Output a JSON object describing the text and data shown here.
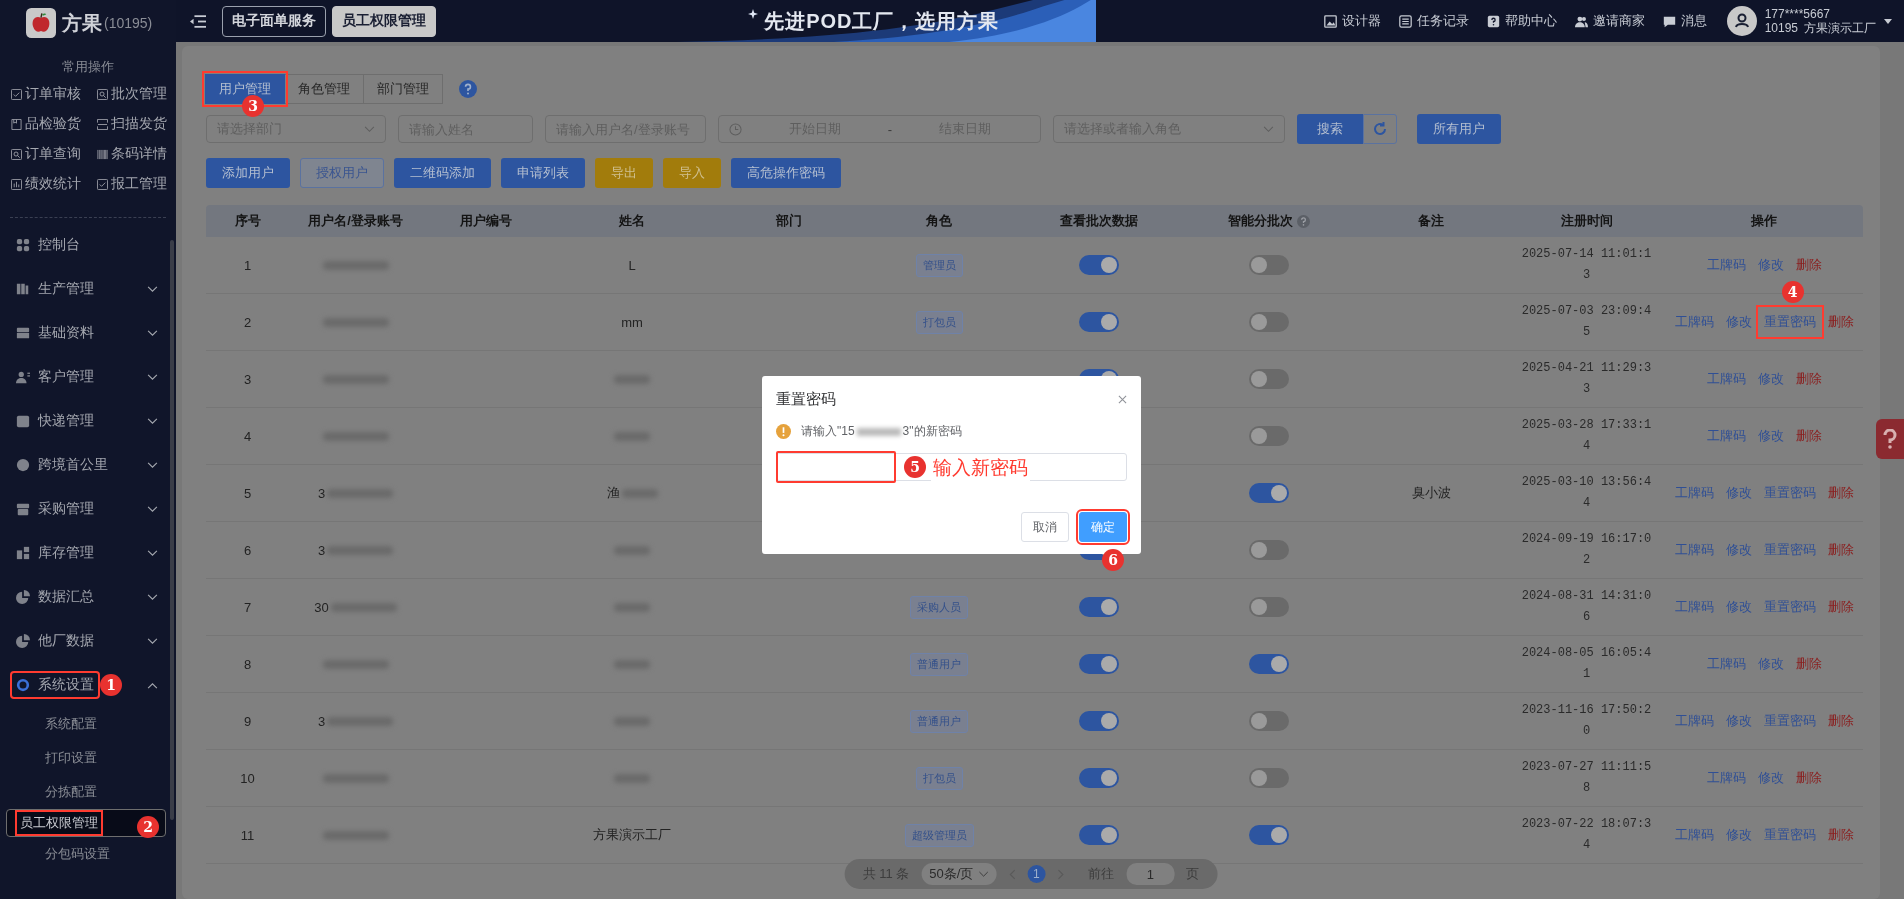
{
  "sidebar": {
    "brand": "方果",
    "brand_id": "(10195)",
    "quick_title": "常用操作",
    "quick_actions": [
      "订单审核",
      "批次管理",
      "品检验货",
      "扫描发货",
      "订单查询",
      "条码详情",
      "绩效统计",
      "报工管理"
    ],
    "menu": [
      {
        "label": "控制台"
      },
      {
        "label": "生产管理",
        "expanded": false
      },
      {
        "label": "基础资料",
        "expanded": false
      },
      {
        "label": "客户管理",
        "expanded": false
      },
      {
        "label": "快递管理",
        "expanded": false
      },
      {
        "label": "跨境首公里",
        "expanded": false
      },
      {
        "label": "采购管理",
        "expanded": false
      },
      {
        "label": "库存管理",
        "expanded": false
      },
      {
        "label": "数据汇总",
        "expanded": false
      },
      {
        "label": "他厂数据",
        "expanded": false
      },
      {
        "label": "系统设置",
        "expanded": true,
        "highlighted": true,
        "step": "1",
        "children": [
          {
            "label": "系统配置",
            "selected": false
          },
          {
            "label": "打印设置",
            "selected": false
          },
          {
            "label": "分拣配置",
            "selected": false
          },
          {
            "label": "员工权限管理",
            "selected": true,
            "highlighted": true,
            "step": "2"
          },
          {
            "label": "分包码设置",
            "selected": false
          }
        ]
      }
    ]
  },
  "topbar": {
    "tabs": [
      {
        "label": "电子面单服务",
        "selected": false
      },
      {
        "label": "员工权限管理",
        "selected": true
      }
    ],
    "banner": "先进POD工厂，选用方果",
    "links": [
      "设计器",
      "任务记录",
      "帮助中心",
      "邀请商家",
      "消息"
    ],
    "user": {
      "phone": "177****5667",
      "org_id": "10195",
      "org": "方果演示工厂"
    }
  },
  "main": {
    "tabs": [
      {
        "label": "用户管理",
        "selected": true,
        "highlighted": true,
        "step": "3"
      },
      {
        "label": "角色管理",
        "selected": false
      },
      {
        "label": "部门管理",
        "selected": false
      }
    ],
    "filters": {
      "department": {
        "placeholder": "请选择部门"
      },
      "name": {
        "placeholder": "请输入姓名"
      },
      "account": {
        "placeholder": "请输入用户名/登录账号"
      },
      "date_start": {
        "placeholder": "开始日期"
      },
      "date_separator": "-",
      "date_end": {
        "placeholder": "结束日期"
      },
      "role": {
        "placeholder": "请选择或者输入角色"
      },
      "search_button": "搜索",
      "all_users_button": "所有用户"
    },
    "buttons": [
      {
        "label": "添加用户",
        "kind": "primary"
      },
      {
        "label": "授权用户",
        "kind": "plain"
      },
      {
        "label": "二维码添加",
        "kind": "primary"
      },
      {
        "label": "申请列表",
        "kind": "primary"
      },
      {
        "label": "导出",
        "kind": "warning"
      },
      {
        "label": "导入",
        "kind": "warning"
      },
      {
        "label": "高危操作密码",
        "kind": "primary"
      }
    ],
    "table": {
      "columns": [
        "序号",
        "用户名/登录账号",
        "用户编号",
        "姓名",
        "部门",
        "角色",
        "查看批次数据",
        "智能分批次",
        "备注",
        "注册时间",
        "操作"
      ],
      "rows": [
        {
          "no": "1",
          "name": "L",
          "role": "管理员",
          "view_batches": true,
          "smart_batch": false,
          "registered": "2025-07-14 11:01:13",
          "actions": [
            {
              "label": "工牌码",
              "kind": "link"
            },
            {
              "label": "修改",
              "kind": "link"
            },
            {
              "label": "删除",
              "kind": "danger"
            }
          ]
        },
        {
          "no": "2",
          "name": "mm",
          "role": "打包员",
          "view_batches": true,
          "smart_batch": false,
          "registered": "2025-07-03 23:09:45",
          "actions": [
            {
              "label": "工牌码",
              "kind": "link"
            },
            {
              "label": "修改",
              "kind": "link"
            },
            {
              "label": "重置密码",
              "kind": "link",
              "highlighted": true,
              "step": "4"
            },
            {
              "label": "删除",
              "kind": "danger"
            }
          ]
        },
        {
          "no": "3",
          "name_redacted": true,
          "view_batches": true,
          "smart_batch": false,
          "registered": "2025-04-21 11:29:33",
          "actions": [
            {
              "label": "工牌码",
              "kind": "link"
            },
            {
              "label": "修改",
              "kind": "link"
            },
            {
              "label": "删除",
              "kind": "danger"
            }
          ]
        },
        {
          "no": "4",
          "name_redacted": true,
          "smart_batch": false,
          "registered": "2025-03-28 17:33:14",
          "actions": [
            {
              "label": "工牌码",
              "kind": "link"
            },
            {
              "label": "修改",
              "kind": "link"
            },
            {
              "label": "删除",
              "kind": "danger"
            }
          ]
        },
        {
          "no": "5",
          "account_prefix": "3",
          "name": "渔",
          "name_redacted": true,
          "smart_batch": true,
          "remark": "臭小波",
          "registered": "2025-03-10 13:56:44",
          "actions": [
            {
              "label": "工牌码",
              "kind": "link"
            },
            {
              "label": "修改",
              "kind": "link"
            },
            {
              "label": "重置密码",
              "kind": "link"
            },
            {
              "label": "删除",
              "kind": "danger"
            }
          ]
        },
        {
          "no": "6",
          "account_prefix": "3",
          "name_redacted": true,
          "view_batches": true,
          "smart_batch": false,
          "registered": "2024-09-19 16:17:02",
          "actions": [
            {
              "label": "工牌码",
              "kind": "link"
            },
            {
              "label": "修改",
              "kind": "link"
            },
            {
              "label": "重置密码",
              "kind": "link"
            },
            {
              "label": "删除",
              "kind": "danger"
            }
          ]
        },
        {
          "no": "7",
          "account_prefix": "30",
          "name_redacted": true,
          "role": "采购人员",
          "view_batches": true,
          "smart_batch": false,
          "registered": "2024-08-31 14:31:06",
          "actions": [
            {
              "label": "工牌码",
              "kind": "link"
            },
            {
              "label": "修改",
              "kind": "link"
            },
            {
              "label": "重置密码",
              "kind": "link"
            },
            {
              "label": "删除",
              "kind": "danger"
            }
          ]
        },
        {
          "no": "8",
          "name_redacted": true,
          "role": "普通用户",
          "view_batches": true,
          "smart_batch": true,
          "registered": "2024-08-05 16:05:41",
          "actions": [
            {
              "label": "工牌码",
              "kind": "link"
            },
            {
              "label": "修改",
              "kind": "link"
            },
            {
              "label": "删除",
              "kind": "danger"
            }
          ]
        },
        {
          "no": "9",
          "account_prefix": "3",
          "name_redacted": true,
          "role": "普通用户",
          "view_batches": true,
          "smart_batch": false,
          "registered": "2023-11-16 17:50:20",
          "actions": [
            {
              "label": "工牌码",
              "kind": "link"
            },
            {
              "label": "修改",
              "kind": "link"
            },
            {
              "label": "重置密码",
              "kind": "link"
            },
            {
              "label": "删除",
              "kind": "danger"
            }
          ]
        },
        {
          "no": "10",
          "name_redacted": true,
          "role": "打包员",
          "view_batches": true,
          "smart_batch": false,
          "registered": "2023-07-27 11:11:58",
          "actions": [
            {
              "label": "工牌码",
              "kind": "link"
            },
            {
              "label": "修改",
              "kind": "link"
            },
            {
              "label": "删除",
              "kind": "danger"
            }
          ]
        },
        {
          "no": "11",
          "name": "方果演示工厂",
          "role": "超级管理员",
          "view_batches": true,
          "smart_batch": true,
          "registered": "2023-07-22 18:07:34",
          "actions": [
            {
              "label": "工牌码",
              "kind": "link"
            },
            {
              "label": "修改",
              "kind": "link"
            },
            {
              "label": "重置密码",
              "kind": "link"
            },
            {
              "label": "删除",
              "kind": "danger"
            }
          ]
        }
      ]
    },
    "pagination": {
      "total": "共 11 条",
      "page_size": "50条/页",
      "pages": [
        {
          "label": "1",
          "selected": true
        }
      ],
      "goto_label": "前往",
      "goto_value": "1",
      "page_suffix": "页"
    }
  },
  "modal": {
    "title": "重置密码",
    "prompt_start": "请输入\"15",
    "prompt_end": "3\"的新密码",
    "input": {
      "highlighted": true,
      "step": "5",
      "note": "输入新密码"
    },
    "buttons": [
      {
        "label": "取消",
        "kind": "default"
      },
      {
        "label": "确定",
        "kind": "primary",
        "highlighted": true,
        "step": "6"
      }
    ]
  }
}
